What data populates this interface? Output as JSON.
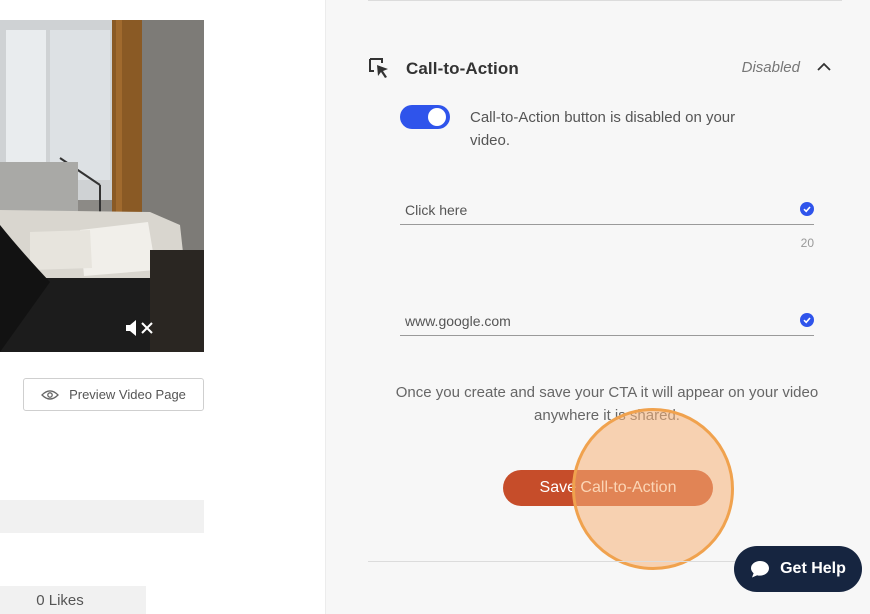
{
  "left": {
    "preview_label": "Preview Video Page",
    "likes_label": "0 Likes"
  },
  "cta": {
    "title": "Call-to-Action",
    "status": "Disabled",
    "toggle_on": true,
    "toggle_text": "Call-to-Action button is disabled on your video.",
    "button_text_value": "Click here",
    "button_text_counter": "20",
    "url_value": "www.google.com",
    "note": "Once you create and save your CTA it will appear on your video anywhere it is shared.",
    "save_label": "Save Call-to-Action"
  },
  "help": {
    "label": "Get Help"
  },
  "colors": {
    "accent": "#2f54eb",
    "save": "#c64d2a",
    "help_bg": "#162540",
    "highlight": "#f0a24e"
  },
  "icons": {
    "cta": "cursor-click-icon",
    "collapse": "chevron-up-icon",
    "preview": "eye-icon",
    "mute": "speaker-muted-icon",
    "help": "chat-bubble-icon"
  }
}
